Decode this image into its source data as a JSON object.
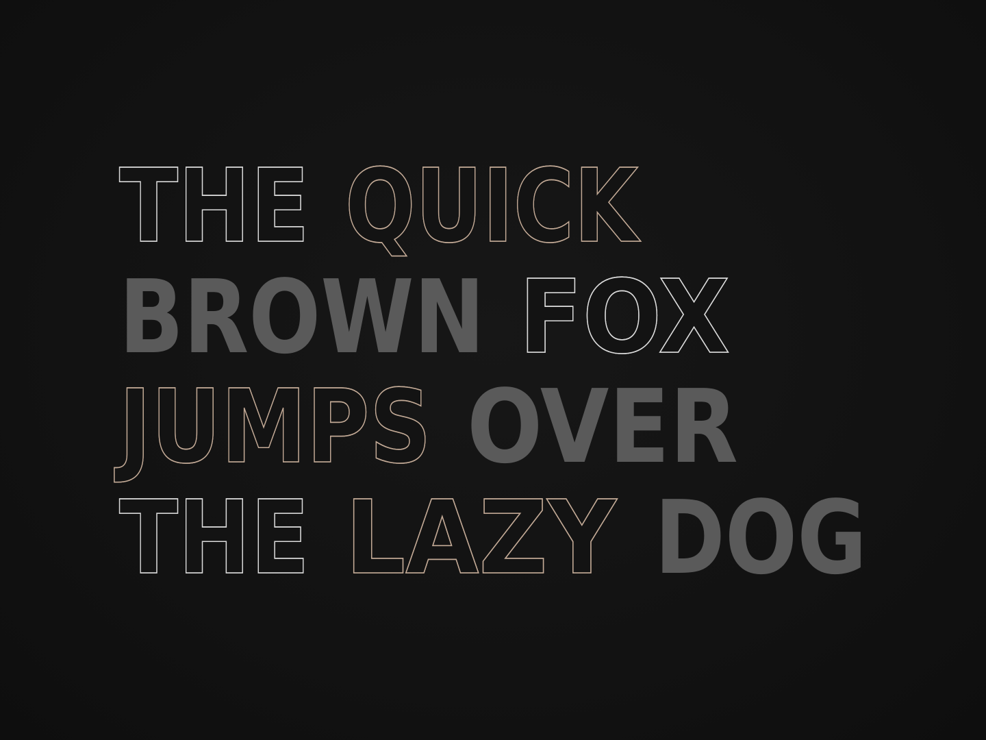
{
  "colors": {
    "background": "#131313",
    "white_inline": "#dcdcdc",
    "tan_inline": "#c4ab97",
    "gray_solid": "#5a5a5a"
  },
  "lines": [
    {
      "words": [
        {
          "text": "THE",
          "style": "triple-inline",
          "color": "white_inline"
        },
        {
          "text": "QUICK",
          "style": "double-inline",
          "color": "tan_inline"
        }
      ]
    },
    {
      "words": [
        {
          "text": "BROWN",
          "style": "solid",
          "color": "gray_solid"
        },
        {
          "text": "FOX",
          "style": "triple-inline",
          "color": "white_inline"
        }
      ]
    },
    {
      "words": [
        {
          "text": "JUMPS",
          "style": "double-inline",
          "color": "tan_inline"
        },
        {
          "text": "OVER",
          "style": "solid",
          "color": "gray_solid"
        }
      ]
    },
    {
      "words": [
        {
          "text": "THE",
          "style": "triple-inline",
          "color": "white_inline"
        },
        {
          "text": "LAZY",
          "style": "double-inline",
          "color": "tan_inline"
        },
        {
          "text": "DOG",
          "style": "solid",
          "color": "gray_solid"
        }
      ]
    }
  ]
}
